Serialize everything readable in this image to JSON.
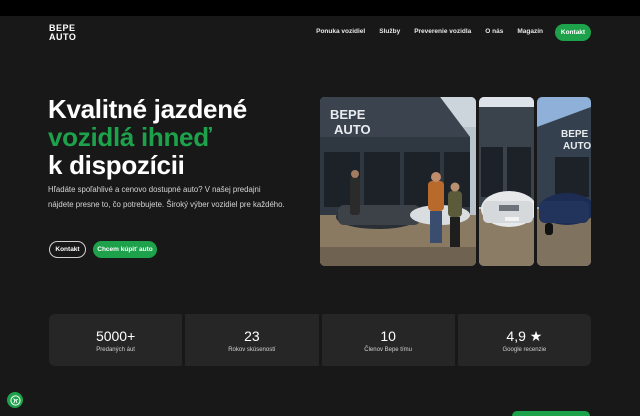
{
  "logo": {
    "line1": "BEPE",
    "line2": "AUTO"
  },
  "nav": {
    "items": [
      "Ponuka vozidiel",
      "Služby",
      "Preverenie vozidla",
      "O nás",
      "Magazín"
    ],
    "cta": "Kontakt"
  },
  "hero": {
    "title_line1": "Kvalitné jazdené",
    "title_line2": "vozidlá ihneď",
    "title_line3": "k dispozícii",
    "text": "Hľadáte spoľahlivé a cenovo dostupné auto? V našej predajni nájdete presne to, čo potrebujete. Široký výber vozidiel pre každého.",
    "btn_contact": "Kontakt",
    "btn_buy": "Chcem kúpiť auto"
  },
  "photos": {
    "sign_line1": "BEPE",
    "sign_line2": "AUTO"
  },
  "stats": [
    {
      "value": "5000+",
      "label": "Predaných áut"
    },
    {
      "value": "23",
      "label": "Rokov skúseností"
    },
    {
      "value": "10",
      "label": "Členov Bepe tímu"
    },
    {
      "value": "4,9 ★",
      "label": "Google recenzie"
    }
  ],
  "colors": {
    "accent": "#1da24b",
    "background": "#181818",
    "card": "#262626"
  },
  "icons": {
    "accessibility": "accessibility-icon"
  }
}
